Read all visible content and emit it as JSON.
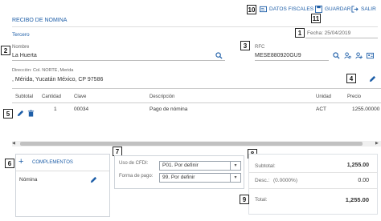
{
  "header": {
    "title": "RECIBO DE NOMINA",
    "datos_fiscales": "DATOS FISCALES",
    "guardar": "GUARDAR",
    "salir": "SALIR"
  },
  "tags": [
    "1",
    "2",
    "3",
    "4",
    "5",
    "6",
    "7",
    "8",
    "9",
    "10",
    "11"
  ],
  "tercero": "Tercero",
  "fecha": "Fecha: 25/04/2019",
  "nombre": {
    "label": "Nombre",
    "value": "La Huerta"
  },
  "rfc": {
    "label": "RFC",
    "value": "MESE880920GU9"
  },
  "direccion": {
    "line1": "Dirección: Col. NORTE, Merida",
    "line2": ", Mérida, Yucatán México, CP 97586"
  },
  "table": {
    "headers": [
      "Subtotal",
      "Cantidad",
      "Clave",
      "Descripción",
      "Unidad",
      "Precio"
    ],
    "rows": [
      {
        "cantidad": "1",
        "clave": "00034",
        "descripcion": "Pago de nómina",
        "unidad": "ACT",
        "precio": "1255.00000"
      }
    ]
  },
  "complementos": {
    "title": "COMPLEMENTOS",
    "items": [
      "Nómina"
    ]
  },
  "cfdi": {
    "uso_label": "Uso de CFDI:",
    "uso_value": "P01. Por definir",
    "pago_label": "Forma de pago:",
    "pago_value": "99. Por definir"
  },
  "totals": {
    "subtotal_label": "Subtotal:",
    "subtotal_value": "1,255.00",
    "desc_label": "Desc.:",
    "desc_pct": "(0.0000%)",
    "desc_value": "0.00",
    "total_label": "Total:",
    "total_value": "1,255.00"
  }
}
